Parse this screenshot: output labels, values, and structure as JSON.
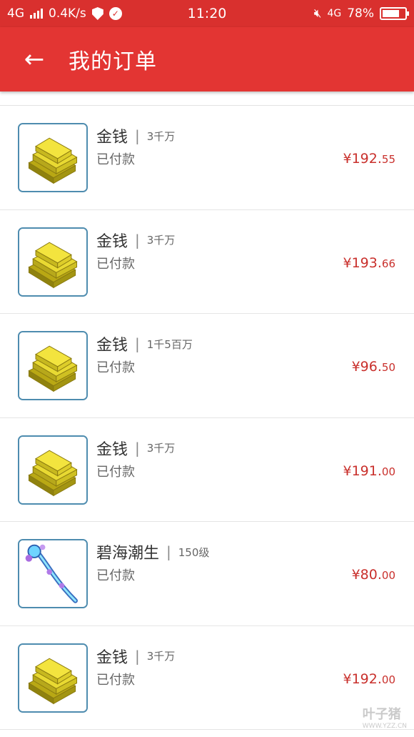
{
  "status_bar": {
    "network": "4G",
    "speed": "0.4K/s",
    "time": "11:20",
    "network_right": "4G",
    "battery": "78%",
    "battery_level": 0.78
  },
  "header": {
    "back_icon": "arrow-left-icon",
    "title": "我的订单"
  },
  "orders": [
    {
      "name": "金钱",
      "qty": "3千万",
      "status": "已付款",
      "price_int": "¥192.",
      "price_dec": "55",
      "thumb": "gold-bars-icon"
    },
    {
      "name": "金钱",
      "qty": "3千万",
      "status": "已付款",
      "price_int": "¥193.",
      "price_dec": "66",
      "thumb": "gold-bars-icon"
    },
    {
      "name": "金钱",
      "qty": "1千5百万",
      "status": "已付款",
      "price_int": "¥96.",
      "price_dec": "50",
      "thumb": "gold-bars-icon"
    },
    {
      "name": "金钱",
      "qty": "3千万",
      "status": "已付款",
      "price_int": "¥191.",
      "price_dec": "00",
      "thumb": "gold-bars-icon"
    },
    {
      "name": "碧海潮生",
      "qty": "150级",
      "status": "已付款",
      "price_int": "¥80.",
      "price_dec": "00",
      "thumb": "staff-weapon-icon"
    },
    {
      "name": "金钱",
      "qty": "3千万",
      "status": "已付款",
      "price_int": "¥192.",
      "price_dec": "00",
      "thumb": "gold-bars-icon"
    }
  ],
  "colors": {
    "status_bar": "#d9302e",
    "app_bar": "#e33533",
    "price": "#c9302c",
    "thumb_border": "#4e8caf"
  },
  "watermark": {
    "text": "叶子猪",
    "url": "WWW.YZZ.CN"
  }
}
